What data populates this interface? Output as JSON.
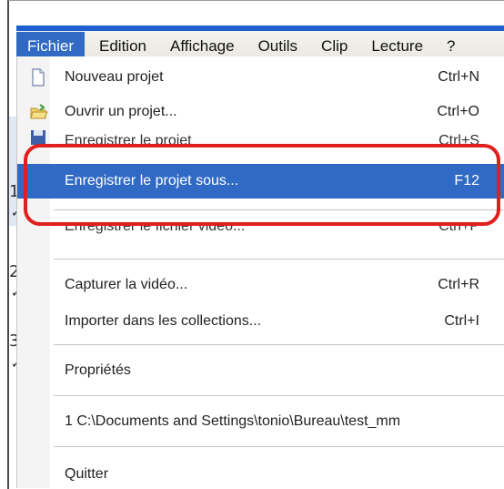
{
  "menubar": {
    "items": [
      "Fichier",
      "Edition",
      "Affichage",
      "Outils",
      "Clip",
      "Lecture",
      "?"
    ]
  },
  "menu": {
    "items": [
      {
        "label": "Nouveau projet",
        "shortcut": "Ctrl+N",
        "icon": "new-document-icon"
      },
      {
        "label": "Ouvrir un projet...",
        "shortcut": "Ctrl+O",
        "icon": "open-folder-icon"
      },
      {
        "label": "Enregistrer le projet",
        "shortcut": "Ctrl+S",
        "icon": "save-icon"
      },
      {
        "label": "Enregistrer le projet sous...",
        "shortcut": "F12",
        "highlighted": true
      },
      {
        "label": "Enregistrer le fichier vidéo...",
        "shortcut": "Ctrl+P"
      },
      {
        "label": "Capturer la vidéo...",
        "shortcut": "Ctrl+R"
      },
      {
        "label": "Importer dans les collections...",
        "shortcut": "Ctrl+I"
      },
      {
        "label": "Propriétés",
        "shortcut": ""
      },
      {
        "label": "1 C:\\Documents and Settings\\tonio\\Bureau\\test_mm",
        "shortcut": ""
      },
      {
        "label": "Quitter",
        "shortcut": ""
      }
    ]
  },
  "left_panel": {
    "digits": [
      "1",
      "2",
      "3"
    ]
  },
  "colors": {
    "accent": "#316ac5",
    "callout": "#e0201f",
    "titlebar": "#1f5fcf"
  }
}
